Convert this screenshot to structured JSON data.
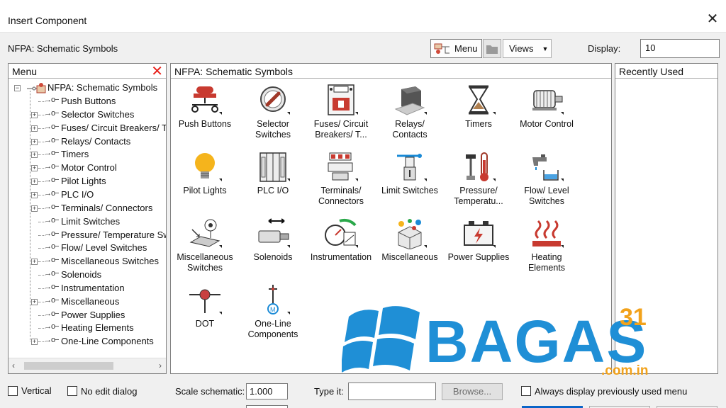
{
  "window": {
    "title": "Insert Component",
    "close_glyph": "✕"
  },
  "toolbar": {
    "section_label": "NFPA: Schematic Symbols",
    "menu_button": "Menu",
    "views_button": "Views",
    "display_label": "Display:",
    "display_value": "10"
  },
  "menu_panel": {
    "title": "Menu",
    "tree_root": "NFPA: Schematic Symbols",
    "tree_items": [
      {
        "label": "Push Buttons",
        "expandable": false
      },
      {
        "label": "Selector Switches",
        "expandable": true
      },
      {
        "label": "Fuses/ Circuit Breakers/ Tr",
        "expandable": true
      },
      {
        "label": "Relays/ Contacts",
        "expandable": true
      },
      {
        "label": "Timers",
        "expandable": true
      },
      {
        "label": "Motor Control",
        "expandable": true
      },
      {
        "label": "Pilot Lights",
        "expandable": true
      },
      {
        "label": "PLC I/O",
        "expandable": true
      },
      {
        "label": "Terminals/ Connectors",
        "expandable": true
      },
      {
        "label": "Limit Switches",
        "expandable": false
      },
      {
        "label": "Pressure/ Temperature Sw",
        "expandable": false
      },
      {
        "label": "Flow/ Level Switches",
        "expandable": false
      },
      {
        "label": "Miscellaneous Switches",
        "expandable": true
      },
      {
        "label": "Solenoids",
        "expandable": false
      },
      {
        "label": "Instrumentation",
        "expandable": false
      },
      {
        "label": "Miscellaneous",
        "expandable": true
      },
      {
        "label": "Power Supplies",
        "expandable": false
      },
      {
        "label": "Heating Elements",
        "expandable": false
      },
      {
        "label": "One-Line Components",
        "expandable": true
      }
    ]
  },
  "symbols_panel": {
    "title": "NFPA: Schematic Symbols",
    "symbols": [
      {
        "l1": "Push Buttons",
        "l2": "",
        "icon": "push-button-icon"
      },
      {
        "l1": "Selector",
        "l2": "Switches",
        "icon": "selector-switch-icon"
      },
      {
        "l1": "Fuses/ Circuit",
        "l2": "Breakers/ T...",
        "icon": "fuse-breaker-icon"
      },
      {
        "l1": "Relays/",
        "l2": "Contacts",
        "icon": "relay-icon"
      },
      {
        "l1": "Timers",
        "l2": "",
        "icon": "hourglass-icon"
      },
      {
        "l1": "Motor Control",
        "l2": "",
        "icon": "motor-icon"
      },
      {
        "l1": "Pilot Lights",
        "l2": "",
        "icon": "light-bulb-icon"
      },
      {
        "l1": "PLC I/O",
        "l2": "",
        "icon": "plc-icon"
      },
      {
        "l1": "Terminals/",
        "l2": "Connectors",
        "icon": "terminal-icon"
      },
      {
        "l1": "Limit Switches",
        "l2": "",
        "icon": "limit-switch-icon"
      },
      {
        "l1": "Pressure/",
        "l2": "Temperatu...",
        "icon": "thermometer-icon"
      },
      {
        "l1": "Flow/ Level",
        "l2": "Switches",
        "icon": "faucet-icon"
      },
      {
        "l1": "Miscellaneous",
        "l2": "Switches",
        "icon": "misc-switch-icon"
      },
      {
        "l1": "Solenoids",
        "l2": "",
        "icon": "solenoid-icon"
      },
      {
        "l1": "Instrumentation",
        "l2": "",
        "icon": "gauge-icon"
      },
      {
        "l1": "Miscellaneous",
        "l2": "",
        "icon": "misc-box-icon"
      },
      {
        "l1": "Power Supplies",
        "l2": "",
        "icon": "battery-icon"
      },
      {
        "l1": "Heating",
        "l2": "Elements",
        "icon": "heating-icon"
      },
      {
        "l1": "DOT",
        "l2": "",
        "icon": "dot-icon"
      },
      {
        "l1": "One-Line",
        "l2": "Components",
        "icon": "one-line-icon"
      }
    ]
  },
  "recent_panel": {
    "title": "Recently Used"
  },
  "watermark": {
    "text": "BAGAS",
    "superscript": "31",
    "domain": ".com.in"
  },
  "bottom": {
    "vertical_label": "Vertical",
    "no_edit_label": "No edit dialog",
    "scale_label": "Scale schematic:",
    "scale_value": "1.000",
    "type_label": "Type it:",
    "type_value": "",
    "browse_label": "Browse...",
    "always_label": "Always display previously used menu"
  },
  "colors": {
    "red_x": "#e8201a",
    "watermark_blue": "#1f8fd6"
  }
}
